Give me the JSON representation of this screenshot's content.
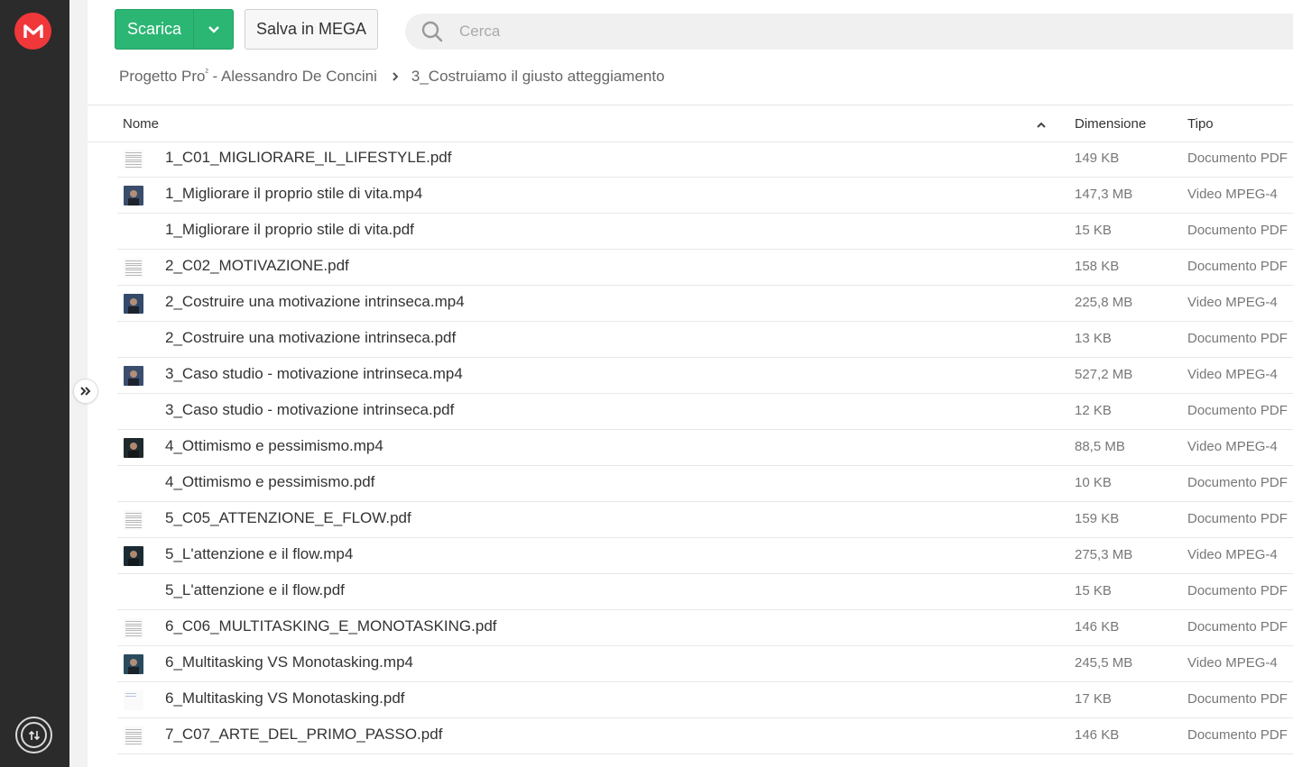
{
  "toolbar": {
    "download_label": "Scarica",
    "save_label": "Salva in MEGA",
    "search_placeholder": "Cerca"
  },
  "breadcrumb": {
    "root_prefix": "Progetto Pro",
    "root_sup": "²",
    "root_suffix": " - Alessandro De Concini",
    "current": "3_Costruiamo il giusto atteggiamento"
  },
  "table": {
    "col_name": "Nome",
    "col_size": "Dimensione",
    "col_type": "Tipo"
  },
  "colors": {
    "brand_red": "#f0373a",
    "download_green": "#2bb673",
    "rail": "#2b2b2b"
  },
  "files": [
    {
      "name": "1_C01_MIGLIORARE_IL_LIFESTYLE.pdf",
      "size": "149 KB",
      "type": "Documento PDF",
      "thumb": "pdf"
    },
    {
      "name": "1_Migliorare il proprio stile di vita.mp4",
      "size": "147,3 MB",
      "type": "Video MPEG-4",
      "thumb": "video",
      "tone": "#3a4d6b"
    },
    {
      "name": "1_Migliorare il proprio stile di vita.pdf",
      "size": "15 KB",
      "type": "Documento PDF",
      "thumb": "blank"
    },
    {
      "name": "2_C02_MOTIVAZIONE.pdf",
      "size": "158 KB",
      "type": "Documento PDF",
      "thumb": "pdf"
    },
    {
      "name": "2_Costruire una motivazione intrinseca.mp4",
      "size": "225,8 MB",
      "type": "Video MPEG-4",
      "thumb": "video",
      "tone": "#344a6a"
    },
    {
      "name": "2_Costruire una motivazione intrinseca.pdf",
      "size": "13 KB",
      "type": "Documento PDF",
      "thumb": "blank"
    },
    {
      "name": "3_Caso studio - motivazione intrinseca.mp4",
      "size": "527,2 MB",
      "type": "Video MPEG-4",
      "thumb": "video",
      "tone": "#3b4e6e"
    },
    {
      "name": "3_Caso studio - motivazione intrinseca.pdf",
      "size": "12 KB",
      "type": "Documento PDF",
      "thumb": "blank"
    },
    {
      "name": "4_Ottimismo e pessimismo.mp4",
      "size": "88,5 MB",
      "type": "Video MPEG-4",
      "thumb": "video",
      "tone": "#1f2a2e"
    },
    {
      "name": "4_Ottimismo e pessimismo.pdf",
      "size": "10 KB",
      "type": "Documento PDF",
      "thumb": "blank"
    },
    {
      "name": "5_C05_ATTENZIONE_E_FLOW.pdf",
      "size": "159 KB",
      "type": "Documento PDF",
      "thumb": "pdf"
    },
    {
      "name": "5_L'attenzione e il flow.mp4",
      "size": "275,3 MB",
      "type": "Video MPEG-4",
      "thumb": "video",
      "tone": "#1a2b33"
    },
    {
      "name": "5_L'attenzione e il flow.pdf",
      "size": "15 KB",
      "type": "Documento PDF",
      "thumb": "blank"
    },
    {
      "name": "6_C06_MULTITASKING_E_MONOTASKING.pdf",
      "size": "146 KB",
      "type": "Documento PDF",
      "thumb": "pdf"
    },
    {
      "name": "6_Multitasking VS Monotasking.mp4",
      "size": "245,5 MB",
      "type": "Video MPEG-4",
      "thumb": "video",
      "tone": "#2b4a5e"
    },
    {
      "name": "6_Multitasking VS Monotasking.pdf",
      "size": "17 KB",
      "type": "Documento PDF",
      "thumb": "pdf-light"
    },
    {
      "name": "7_C07_ARTE_DEL_PRIMO_PASSO.pdf",
      "size": "146 KB",
      "type": "Documento PDF",
      "thumb": "pdf"
    }
  ]
}
